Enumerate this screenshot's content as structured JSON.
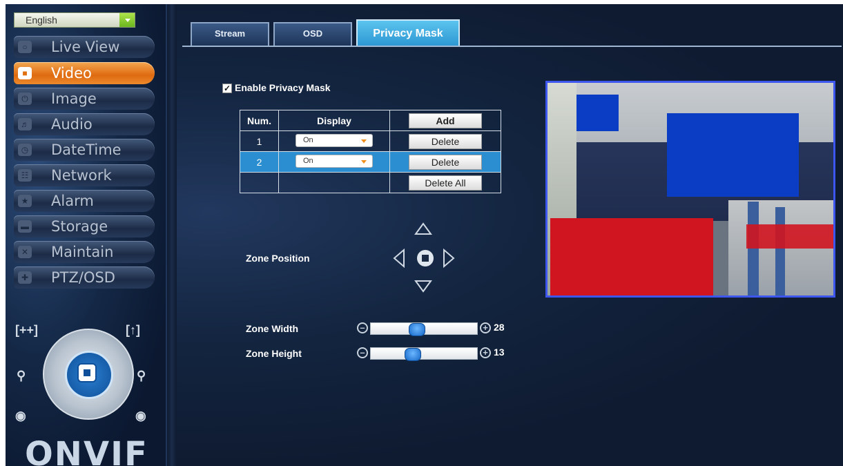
{
  "language": {
    "selected": "English"
  },
  "nav": [
    {
      "label": "Live View",
      "icon": "chat-bubble-icon"
    },
    {
      "label": "Video",
      "icon": "video-camera-icon",
      "active": true
    },
    {
      "label": "Image",
      "icon": "power-icon"
    },
    {
      "label": "Audio",
      "icon": "speaker-icon"
    },
    {
      "label": "DateTime",
      "icon": "clock-icon"
    },
    {
      "label": "Network",
      "icon": "network-icon"
    },
    {
      "label": "Alarm",
      "icon": "alarm-star-icon"
    },
    {
      "label": "Storage",
      "icon": "storage-drive-icon"
    },
    {
      "label": "Maintain",
      "icon": "tools-icon"
    },
    {
      "label": "PTZ/OSD",
      "icon": "ptz-arrows-icon"
    }
  ],
  "logo": "ONVIF",
  "tabs": [
    {
      "label": "Stream"
    },
    {
      "label": "OSD"
    },
    {
      "label": "Privacy Mask",
      "active": true
    }
  ],
  "privacy": {
    "enable_label": "Enable Privacy Mask",
    "enabled": true,
    "table": {
      "headers": [
        "Num.",
        "Display",
        ""
      ],
      "add_label": "Add",
      "delete_label": "Delete",
      "delete_all_label": "Delete All",
      "rows": [
        {
          "num": "1",
          "display": "On"
        },
        {
          "num": "2",
          "display": "On",
          "selected": true
        }
      ]
    },
    "zone_position_label": "Zone Position",
    "zone_width": {
      "label": "Zone Width",
      "value": "28",
      "fraction": 0.42
    },
    "zone_height": {
      "label": "Zone Height",
      "value": "13",
      "fraction": 0.38
    }
  },
  "colors": {
    "accent_active_nav": "#e87a1e",
    "mask_color": "#0a3cc4",
    "preview_border": "#3d57ee",
    "selected_row": "#2a8ed0"
  }
}
